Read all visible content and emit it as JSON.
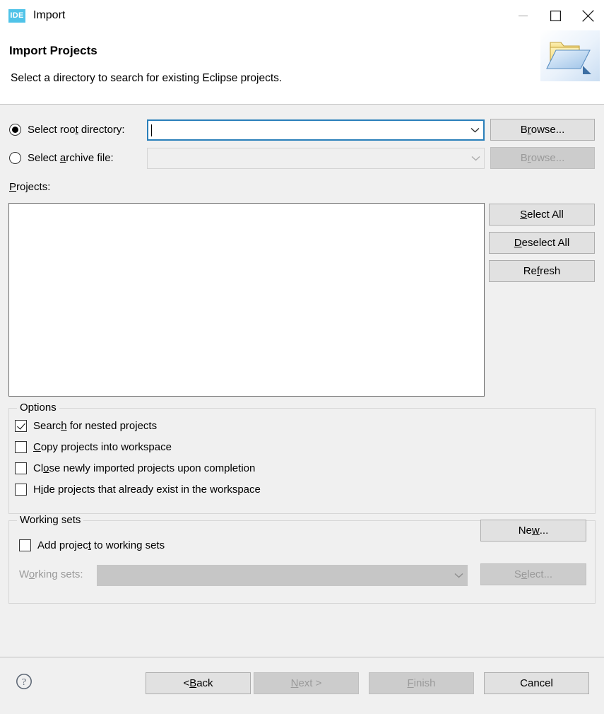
{
  "window": {
    "title": "Import",
    "app_icon_text": "IDE",
    "controls": {
      "minimize": "minimize-icon",
      "maximize": "maximize-icon",
      "close": "close-icon"
    }
  },
  "header": {
    "title": "Import Projects",
    "description": "Select a directory to search for existing Eclipse projects.",
    "banner_icon": "folder-import-icon"
  },
  "source": {
    "root_directory": {
      "label_pre": "Select roo",
      "label_mnemonic": "t",
      "label_post": " directory:",
      "label_full": "Select root directory:",
      "selected": true,
      "value": "",
      "browse": {
        "pre": "B",
        "mnemonic": "r",
        "post": "owse...",
        "full": "Browse...",
        "enabled": true
      }
    },
    "archive_file": {
      "label_pre": "Select ",
      "label_mnemonic": "a",
      "label_post": "rchive file:",
      "label_full": "Select archive file:",
      "selected": false,
      "value": "",
      "browse": {
        "pre": "B",
        "mnemonic": "r",
        "post": "owse...",
        "full": "Browse...",
        "enabled": false
      }
    }
  },
  "projects": {
    "label_mnemonic": "P",
    "label_post": "rojects:",
    "label_full": "Projects:",
    "items": [],
    "buttons": [
      {
        "pre": "",
        "mnemonic": "S",
        "post": "elect All",
        "full": "Select All",
        "enabled": true,
        "name": "select-all-button"
      },
      {
        "pre": "",
        "mnemonic": "D",
        "post": "eselect All",
        "full": "Deselect All",
        "enabled": true,
        "name": "deselect-all-button"
      },
      {
        "pre": "Re",
        "mnemonic": "f",
        "post": "resh",
        "full": "Refresh",
        "enabled": true,
        "name": "refresh-button"
      }
    ]
  },
  "options": {
    "title": "Options",
    "items": [
      {
        "pre": "Searc",
        "mnemonic": "h",
        "post": " for nested projects",
        "full": "Search for nested projects",
        "checked": true,
        "name": "search-nested-projects-checkbox"
      },
      {
        "pre": "",
        "mnemonic": "C",
        "post": "opy projects into workspace",
        "full": "Copy projects into workspace",
        "checked": false,
        "name": "copy-projects-checkbox"
      },
      {
        "pre": "Cl",
        "mnemonic": "o",
        "post": "se newly imported projects upon completion",
        "full": "Close newly imported projects upon completion",
        "checked": false,
        "name": "close-imported-projects-checkbox"
      },
      {
        "pre": "H",
        "mnemonic": "i",
        "post": "de projects that already exist in the workspace",
        "full": "Hide projects that already exist in the workspace",
        "checked": false,
        "name": "hide-existing-projects-checkbox"
      }
    ]
  },
  "working_sets": {
    "title": "Working sets",
    "add_checkbox": {
      "pre": "Add projec",
      "mnemonic": "t",
      "post": " to working sets",
      "full": "Add project to working sets",
      "checked": false
    },
    "field_label": {
      "pre": "W",
      "mnemonic": "o",
      "post": "rking sets:",
      "full": "Working sets:",
      "enabled": false
    },
    "field_value": "",
    "new_button": {
      "pre": "Ne",
      "mnemonic": "w",
      "post": "...",
      "full": "New...",
      "enabled": true
    },
    "select_button": {
      "pre": "S",
      "mnemonic": "e",
      "post": "lect...",
      "full": "Select...",
      "enabled": false
    }
  },
  "footer": {
    "help_icon": "help-icon",
    "back": {
      "pre": "< ",
      "mnemonic": "B",
      "post": "ack",
      "full": "< Back",
      "enabled": true
    },
    "next": {
      "pre": "",
      "mnemonic": "N",
      "post": "ext >",
      "full": "Next >",
      "enabled": false
    },
    "finish": {
      "pre": "",
      "mnemonic": "F",
      "post": "inish",
      "full": "Finish",
      "enabled": false
    },
    "cancel": {
      "pre": "Cancel",
      "mnemonic": "",
      "post": "",
      "full": "Cancel",
      "enabled": true
    }
  },
  "colors": {
    "dialog_bg": "#f0f0f0",
    "header_bg": "#ffffff",
    "focus_border": "#2a7fba",
    "button_bg": "#e1e1e1",
    "disabled_text": "#9a9a9a",
    "accent_icon": "#4fc3e8"
  }
}
